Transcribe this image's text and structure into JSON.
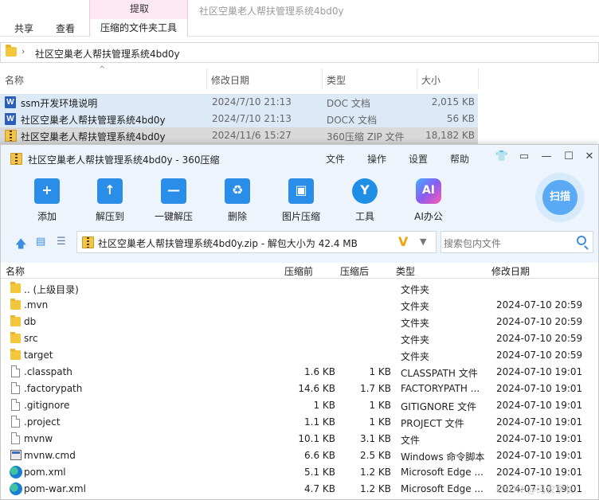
{
  "explorer": {
    "tool_group_title": "提取",
    "tabs": [
      "共享",
      "查看"
    ],
    "active_tab": "压缩的文件夹工具",
    "window_title": "社区空巢老人帮扶管理系统4bd0y",
    "address_chevron": "›",
    "address": "社区空巢老人帮扶管理系统4bd0y",
    "columns": {
      "name": "名称",
      "date": "修改日期",
      "type": "类型",
      "size": "大小"
    },
    "rows": [
      {
        "name": "ssm开发环境说明",
        "date": "2024/7/10 21:13",
        "type": "DOC 文档",
        "size": "2,015 KB",
        "icon": "word-icon",
        "icon_glyph": "W"
      },
      {
        "name": "社区空巢老人帮扶管理系统4bd0y",
        "date": "2024/7/10 21:13",
        "type": "DOCX 文档",
        "size": "56 KB",
        "icon": "word-icon",
        "icon_glyph": "W"
      },
      {
        "name": "社区空巢老人帮扶管理系统4bd0y",
        "date": "2024/11/6 15:27",
        "type": "360压缩 ZIP 文件",
        "size": "18,182 KB",
        "icon": "zip-icon"
      }
    ]
  },
  "zip": {
    "title": "社区空巢老人帮扶管理系统4bd0y - 360压缩",
    "menu": [
      "文件",
      "操作",
      "设置",
      "帮助"
    ],
    "toolbar": [
      {
        "label": "添加",
        "glyph": "+",
        "color": "#2a8ee8"
      },
      {
        "label": "解压到",
        "glyph": "↑",
        "color": "#2a8ee8"
      },
      {
        "label": "一键解压",
        "glyph": "—",
        "color": "#2a8ee8"
      },
      {
        "label": "删除",
        "glyph": "♻",
        "color": "#2a8ee8"
      },
      {
        "label": "图片压缩",
        "glyph": "▣",
        "color": "#2a8ee8"
      },
      {
        "label": "工具",
        "glyph": "Y",
        "color": "#1f8fe6"
      },
      {
        "label": "AI办公",
        "glyph": "AI",
        "color": "#8a5cf0"
      }
    ],
    "scan_label": "扫描",
    "address": "社区空巢老人帮扶管理系统4bd0y.zip - 解包大小为 42.4 MB",
    "v_badge": "V",
    "search_placeholder": "搜索包内文件",
    "columns": {
      "name": "名称",
      "before": "压缩前",
      "after": "压缩后",
      "type": "类型",
      "date": "修改日期"
    },
    "rows": [
      {
        "name": ".. (上级目录)",
        "before": "",
        "after": "",
        "type": "文件夹",
        "date": "",
        "icon": "folder-icon"
      },
      {
        "name": ".mvn",
        "before": "",
        "after": "",
        "type": "文件夹",
        "date": "2024-07-10 20:59",
        "icon": "folder-icon"
      },
      {
        "name": "db",
        "before": "",
        "after": "",
        "type": "文件夹",
        "date": "2024-07-10 20:59",
        "icon": "folder-icon"
      },
      {
        "name": "src",
        "before": "",
        "after": "",
        "type": "文件夹",
        "date": "2024-07-10 20:59",
        "icon": "folder-icon"
      },
      {
        "name": "target",
        "before": "",
        "after": "",
        "type": "文件夹",
        "date": "2024-07-10 20:59",
        "icon": "folder-icon"
      },
      {
        "name": ".classpath",
        "before": "1.6 KB",
        "after": "1 KB",
        "type": "CLASSPATH 文件",
        "date": "2024-07-10 19:01",
        "icon": "file-icon"
      },
      {
        "name": ".factorypath",
        "before": "14.6 KB",
        "after": "1.7 KB",
        "type": "FACTORYPATH ...",
        "date": "2024-07-10 19:01",
        "icon": "file-icon"
      },
      {
        "name": ".gitignore",
        "before": "1 KB",
        "after": "1 KB",
        "type": "GITIGNORE 文件",
        "date": "2024-07-10 19:01",
        "icon": "file-icon"
      },
      {
        "name": ".project",
        "before": "1.1 KB",
        "after": "1 KB",
        "type": "PROJECT 文件",
        "date": "2024-07-10 19:01",
        "icon": "file-icon"
      },
      {
        "name": "mvnw",
        "before": "10.1 KB",
        "after": "3.1 KB",
        "type": "文件",
        "date": "2024-07-10 19:01",
        "icon": "file-icon"
      },
      {
        "name": "mvnw.cmd",
        "before": "6.6 KB",
        "after": "2.5 KB",
        "type": "Windows 命令脚本",
        "date": "2024-07-10 19:01",
        "icon": "cmd-icon"
      },
      {
        "name": "pom.xml",
        "before": "5.1 KB",
        "after": "1.2 KB",
        "type": "Microsoft Edge ...",
        "date": "2024-07-10 19:01",
        "icon": "edge-icon"
      },
      {
        "name": "pom-war.xml",
        "before": "4.7 KB",
        "after": "1.2 KB",
        "type": "Microsoft Edge ...",
        "date": "2024-07-10 19:01",
        "icon": "edge-icon"
      }
    ]
  },
  "watermark": "CSDN @码农学长"
}
